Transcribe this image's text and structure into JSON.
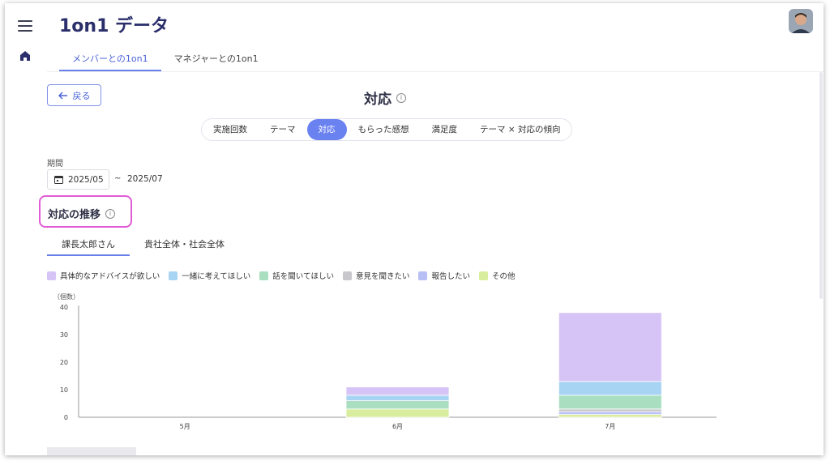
{
  "app": {
    "title": "1on1 データ"
  },
  "tabs": [
    {
      "label": "メンバーとの1on1",
      "active": true
    },
    {
      "label": "マネジャーとの1on1",
      "active": false
    }
  ],
  "back_button": {
    "label": "戻る"
  },
  "section": {
    "title": "対応"
  },
  "segments": [
    {
      "label": "実施回数",
      "active": false
    },
    {
      "label": "テーマ",
      "active": false
    },
    {
      "label": "対応",
      "active": true
    },
    {
      "label": "もらった感想",
      "active": false
    },
    {
      "label": "満足度",
      "active": false
    },
    {
      "label": "テーマ × 対応の傾向",
      "active": false
    }
  ],
  "period": {
    "label": "期間",
    "from": "2025/05",
    "separator": "~",
    "to": "2025/07"
  },
  "chart_heading": "対応の推移",
  "subtabs": [
    {
      "label": "課長太郎さん",
      "active": true
    },
    {
      "label": "貴社全体・社会全体",
      "active": false
    }
  ],
  "colors": {
    "accent": "#6a82f0",
    "highlight": "#e05bd6"
  },
  "chart_data": {
    "type": "bar",
    "stacked": true,
    "ylabel": "（個数）",
    "categories": [
      "5月",
      "6月",
      "7月"
    ],
    "ylim": [
      0,
      40
    ],
    "yticks": [
      0,
      10,
      20,
      30,
      40
    ],
    "series": [
      {
        "name": "その他",
        "color": "#d8ee9e",
        "values": [
          0,
          3,
          1
        ]
      },
      {
        "name": "報告したい",
        "color": "#b8bff5",
        "values": [
          0,
          0,
          1
        ]
      },
      {
        "name": "意見を聞きたい",
        "color": "#c8c8cc",
        "values": [
          0,
          0,
          1
        ]
      },
      {
        "name": "話を聞いてほしい",
        "color": "#a9dfc0",
        "values": [
          0,
          3,
          5
        ]
      },
      {
        "name": "一緒に考えてほしい",
        "color": "#a8d4f4",
        "values": [
          0,
          2,
          5
        ]
      },
      {
        "name": "具体的なアドバイスが欲しい",
        "color": "#d7c4f6",
        "values": [
          0,
          3,
          25
        ]
      }
    ],
    "legend_order": [
      "具体的なアドバイスが欲しい",
      "一緒に考えてほしい",
      "話を聞いてほしい",
      "意見を聞きたい",
      "報告したい",
      "その他"
    ],
    "legend": "top-left"
  }
}
